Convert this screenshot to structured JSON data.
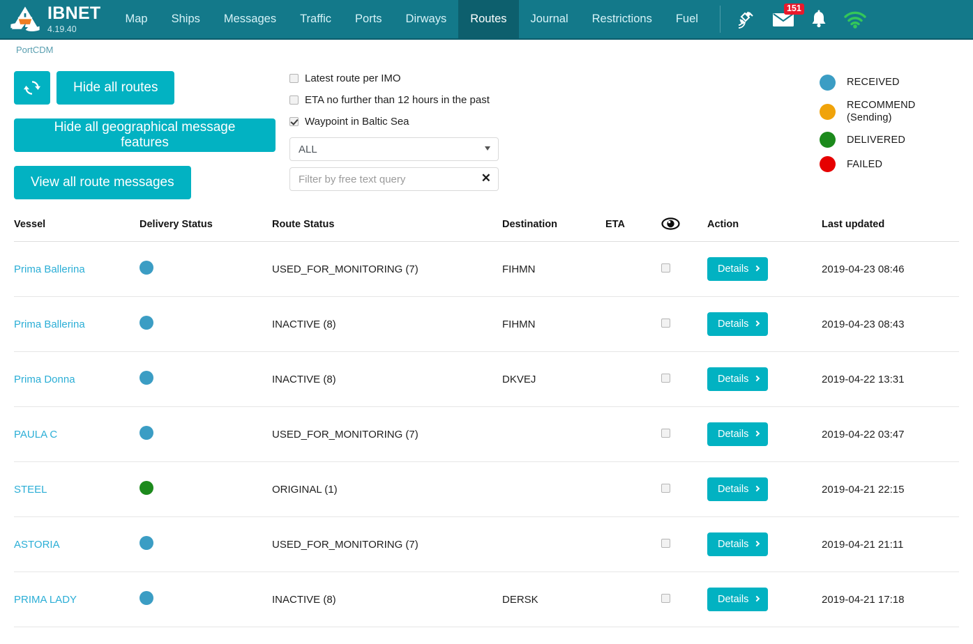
{
  "brand": {
    "name": "IBNET",
    "version": "4.19.40",
    "logo_icon": "ship-triangle-logo"
  },
  "nav": {
    "items": [
      {
        "label": "Map",
        "active": false
      },
      {
        "label": "Ships",
        "active": false
      },
      {
        "label": "Messages",
        "active": false
      },
      {
        "label": "Traffic",
        "active": false
      },
      {
        "label": "Ports",
        "active": false
      },
      {
        "label": "Dirways",
        "active": false
      },
      {
        "label": "Routes",
        "active": true
      },
      {
        "label": "Journal",
        "active": false
      },
      {
        "label": "Restrictions",
        "active": false
      },
      {
        "label": "Fuel",
        "active": false
      }
    ],
    "icons": [
      {
        "name": "satellite-icon",
        "badge": null
      },
      {
        "name": "envelope-icon",
        "badge": "151"
      },
      {
        "name": "bell-icon",
        "badge": null
      },
      {
        "name": "wifi-icon",
        "badge": null
      }
    ]
  },
  "left_controls": {
    "portcdm_label": "PortCDM",
    "refresh_icon": "refresh-icon",
    "hide_all_routes": "Hide all routes",
    "hide_geo_features": "Hide all geographical message features",
    "view_all_messages": "View all route messages"
  },
  "filters": {
    "checkboxes": [
      {
        "label": "Latest route per IMO",
        "checked": false
      },
      {
        "label": "ETA no further than 12 hours in the past",
        "checked": false
      },
      {
        "label": "Waypoint in Baltic Sea",
        "checked": true
      }
    ],
    "select_value": "ALL",
    "text_placeholder": "Filter by free text query",
    "text_value": "",
    "clear_icon": "✕"
  },
  "legend": {
    "items": [
      {
        "label": "RECEIVED",
        "color": "#3b9dc4"
      },
      {
        "label": "RECOMMEND\n(Sending)",
        "label_line1": "RECOMMEND",
        "label_line2": "(Sending)",
        "color": "#f0a30a"
      },
      {
        "label": "DELIVERED",
        "color": "#1c8a1c"
      },
      {
        "label": "FAILED",
        "color": "#e60000"
      }
    ]
  },
  "table": {
    "headers": {
      "vessel": "Vessel",
      "delivery_status": "Delivery Status",
      "route_status": "Route Status",
      "destination": "Destination",
      "eta": "ETA",
      "eye": "eye-icon",
      "action": "Action",
      "last_updated": "Last updated"
    },
    "details_label": "Details",
    "rows": [
      {
        "vessel": "Prima Ballerina",
        "delivery_color": "#3b9dc4",
        "delivery_state": "RECEIVED",
        "route_status": "USED_FOR_MONITORING (7)",
        "destination": "FIHMN",
        "eta": "",
        "selected": false,
        "last_updated": "2019-04-23 08:46"
      },
      {
        "vessel": "Prima Ballerina",
        "delivery_color": "#3b9dc4",
        "delivery_state": "RECEIVED",
        "route_status": "INACTIVE (8)",
        "destination": "FIHMN",
        "eta": "",
        "selected": false,
        "last_updated": "2019-04-23 08:43"
      },
      {
        "vessel": "Prima Donna",
        "delivery_color": "#3b9dc4",
        "delivery_state": "RECEIVED",
        "route_status": "INACTIVE (8)",
        "destination": "DKVEJ",
        "eta": "",
        "selected": false,
        "last_updated": "2019-04-22 13:31"
      },
      {
        "vessel": "PAULA C",
        "delivery_color": "#3b9dc4",
        "delivery_state": "RECEIVED",
        "route_status": "USED_FOR_MONITORING (7)",
        "destination": "",
        "eta": "",
        "selected": false,
        "last_updated": "2019-04-22 03:47"
      },
      {
        "vessel": "STEEL",
        "delivery_color": "#1c8a1c",
        "delivery_state": "DELIVERED",
        "route_status": "ORIGINAL (1)",
        "destination": "",
        "eta": "",
        "selected": false,
        "last_updated": "2019-04-21 22:15"
      },
      {
        "vessel": "ASTORIA",
        "delivery_color": "#3b9dc4",
        "delivery_state": "RECEIVED",
        "route_status": "USED_FOR_MONITORING (7)",
        "destination": "",
        "eta": "",
        "selected": false,
        "last_updated": "2019-04-21 21:11"
      },
      {
        "vessel": "PRIMA LADY",
        "delivery_color": "#3b9dc4",
        "delivery_state": "RECEIVED",
        "route_status": "INACTIVE (8)",
        "destination": "DERSK",
        "eta": "",
        "selected": false,
        "last_updated": "2019-04-21 17:18"
      }
    ]
  },
  "colors": {
    "nav_bg": "#13798a",
    "nav_active_bg": "#0d5f6d",
    "button_teal": "#02b2c2",
    "link_blue": "#2baed6",
    "badge_red": "#e8192c"
  }
}
